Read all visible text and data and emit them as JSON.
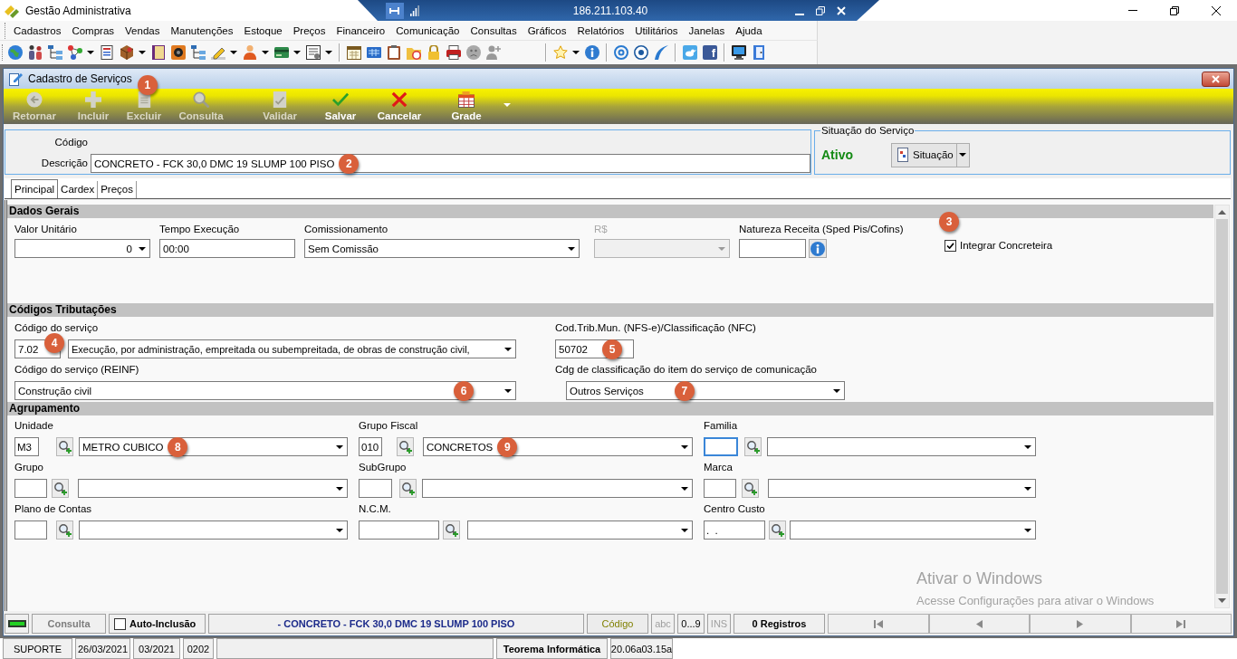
{
  "app": {
    "title": "Gestão Administrativa"
  },
  "remote_bar": {
    "address": "186.211.103.40"
  },
  "menu": [
    "Cadastros",
    "Compras",
    "Vendas",
    "Manutenções",
    "Estoque",
    "Preços",
    "Financeiro",
    "Comunicação",
    "Consultas",
    "Gráficos",
    "Relatórios",
    "Utilitários",
    "Janelas",
    "Ajuda"
  ],
  "toolbar": {
    "groups": [
      [
        {
          "dropdown": false
        },
        {
          "dropdown": false
        },
        {
          "dropdown": false
        },
        {
          "dropdown": true
        },
        {
          "dropdown": false
        },
        {
          "dropdown": true
        },
        {
          "dropdown": false
        },
        {
          "dropdown": false
        },
        {
          "dropdown": false
        },
        {
          "dropdown": true
        },
        {
          "dropdown": true
        },
        {
          "dropdown": true
        },
        {
          "dropdown": true
        }
      ],
      [
        {
          "dropdown": false
        },
        {
          "dropdown": false
        },
        {
          "dropdown": false
        },
        {
          "dropdown": false
        },
        {
          "dropdown": false
        },
        {
          "dropdown": false
        },
        {
          "dropdown": false
        },
        {
          "dropdown": false
        }
      ],
      [
        {
          "dropdown": true
        },
        {
          "dropdown": false
        }
      ],
      [
        {
          "dropdown": false
        },
        {
          "dropdown": false
        },
        {
          "dropdown": false
        }
      ],
      [
        {
          "dropdown": false
        },
        {
          "dropdown": false,
          "glyph": "f"
        }
      ],
      [
        {
          "dropdown": false
        },
        {
          "dropdown": false
        }
      ]
    ]
  },
  "form_window": {
    "title": "Cadastro de Serviços",
    "marker": "1"
  },
  "actions": [
    {
      "label": "Retornar",
      "disabled": true
    },
    {
      "label": "Incluir",
      "disabled": true
    },
    {
      "label": "Excluir",
      "disabled": true
    },
    {
      "label": "Consulta",
      "disabled": true
    },
    {
      "label": "Validar",
      "disabled": true
    },
    {
      "label": "Salvar",
      "disabled": false
    },
    {
      "label": "Cancelar",
      "disabled": false
    },
    {
      "label": "Grade",
      "disabled": false
    }
  ],
  "record": {
    "codigo_label": "Código",
    "descricao_label": "Descrição",
    "descricao": "CONCRETO - FCK 30,0 DMC 19 SLUMP 100 PISO",
    "marker": "2"
  },
  "situacao": {
    "title": "Situação do Serviço",
    "status": "Ativo",
    "button": "Situação"
  },
  "tabs": [
    {
      "label": "Principal",
      "selected": true
    },
    {
      "label": "Cardex",
      "selected": false
    },
    {
      "label": "Preços",
      "selected": false
    }
  ],
  "dados_gerais": {
    "title": "Dados Gerais",
    "fields": [
      {
        "kind": "number",
        "label": "Valor Unitário",
        "value": "0",
        "disabled": false
      },
      {
        "kind": "text",
        "label": "Tempo Execução",
        "value": "00:00",
        "disabled": false
      },
      {
        "kind": "combo",
        "label": "Comissionamento",
        "value": "Sem Comissão",
        "disabled": false
      },
      {
        "kind": "combo",
        "label": "R$",
        "disabled": true
      },
      {
        "kind": "info",
        "label": "Natureza Receita (Sped Pis/Cofins)",
        "disabled": false
      }
    ],
    "checkbox": {
      "label": "Integrar Concreteira",
      "checked": true,
      "marker": "3"
    }
  },
  "codigos": {
    "title": "Códigos Tributações",
    "servico": {
      "label": "Código do serviço",
      "code": "7.02",
      "code_marker": "4",
      "description": "Execução, por administração, empreitada ou subempreitada, de obras de construção civil,"
    },
    "cod_trib_mun": {
      "label": "Cod.Trib.Mun. (NFS-e)/Classificação (NFC)",
      "value": "50702",
      "marker": "5"
    },
    "reinf": {
      "label": "Código do serviço (REINF)",
      "value": "Construção civil",
      "marker": "6"
    },
    "classificacao": {
      "label": "Cdg de classificação do item do serviço de comunicação",
      "value": "Outros Serviços",
      "marker": "7"
    }
  },
  "agrupamento": {
    "title": "Agrupamento",
    "lookups": [
      {
        "label": "Unidade",
        "code": "M3",
        "value": "METRO CUBICO",
        "marker": "8",
        "focused": false
      },
      {
        "label": "Grupo Fiscal",
        "code": "010",
        "value": "CONCRETOS",
        "marker": "9",
        "focused": false
      },
      {
        "label": "Familia",
        "focused": true
      },
      {
        "label": "Grupo",
        "focused": false
      },
      {
        "label": "SubGrupo",
        "focused": false
      },
      {
        "label": "Marca",
        "focused": false
      },
      {
        "label": "Plano de Contas",
        "focused": false
      },
      {
        "label": "N.C.M.",
        "focused": false
      },
      {
        "label": "Centro Custo",
        "code": ".  .",
        "focused": false
      }
    ]
  },
  "status_bar": {
    "mode": {
      "label": "Consulta",
      "disabled": true
    },
    "auto_inclusao": {
      "label": "Auto-Inclusão",
      "checked": false
    },
    "record": "- CONCRETO - FCK 30,0 DMC 19 SLUMP 100 PISO",
    "order": "Código",
    "indicators": [
      {
        "label": "abc",
        "on": false
      },
      {
        "label": "0...9",
        "on": true
      },
      {
        "label": "INS",
        "on": false
      }
    ],
    "count": "0 Registros",
    "nav": [
      {
        "kind": "first"
      },
      {
        "kind": "previous"
      },
      {
        "kind": "next"
      },
      {
        "kind": "last"
      }
    ]
  },
  "footer": {
    "user": "SUPORTE",
    "date": "26/03/2021",
    "period": "03/2021",
    "code": "0202",
    "company": "Teorema Informática",
    "version": "20.06a03.15a"
  },
  "activation_notice": {
    "title": "Ativar o Windows",
    "text": "Acesse Configurações para ativar o Windows"
  }
}
